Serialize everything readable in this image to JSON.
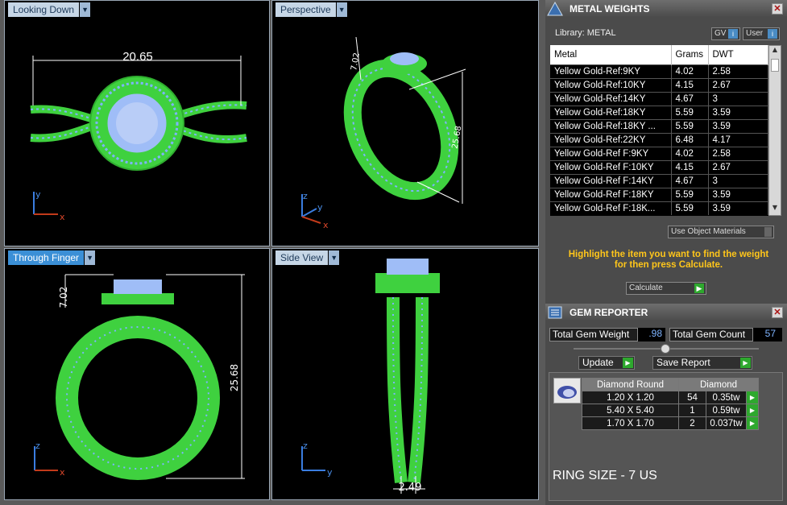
{
  "viewports": {
    "top_left": {
      "tab": "Looking Down",
      "dimension": "20.65",
      "axis_y": "y",
      "axis_x": "x"
    },
    "top_right": {
      "tab": "Perspective",
      "dim_height": "7.02",
      "dim_length": "25.68",
      "axis_z": "z",
      "axis_y": "y",
      "axis_x": "x"
    },
    "bottom_left": {
      "tab": "Through Finger",
      "dim_height": "7.02",
      "dim_length": "25.68",
      "axis_z": "z",
      "axis_x": "x"
    },
    "bottom_right": {
      "tab": "Side View",
      "dim_width": "2.49",
      "axis_z": "z",
      "axis_y": "y"
    }
  },
  "metal_weights": {
    "title": "METAL WEIGHTS",
    "library": "Library: METAL",
    "gv_label": "GV",
    "user_label": "User",
    "columns": [
      "Metal",
      "Grams",
      "DWT"
    ],
    "rows": [
      [
        "Yellow Gold-Ref:9KY",
        "4.02",
        "2.58"
      ],
      [
        "Yellow Gold-Ref:10KY",
        "4.15",
        "2.67"
      ],
      [
        "Yellow Gold-Ref:14KY",
        "4.67",
        "3"
      ],
      [
        "Yellow Gold-Ref:18KY",
        "5.59",
        "3.59"
      ],
      [
        "Yellow Gold-Ref:18KY ...",
        "5.59",
        "3.59"
      ],
      [
        "Yellow Gold-Ref:22KY",
        "6.48",
        "4.17"
      ],
      [
        "Yellow Gold-Ref F:9KY",
        "4.02",
        "2.58"
      ],
      [
        "Yellow Gold-Ref F:10KY",
        "4.15",
        "2.67"
      ],
      [
        "Yellow Gold-Ref F:14KY",
        "4.67",
        "3"
      ],
      [
        "Yellow Gold-Ref F:18KY",
        "5.59",
        "3.59"
      ],
      [
        "Yellow Gold-Ref F:18K...",
        "5.59",
        "3.59"
      ]
    ],
    "use_object_materials": "Use Object Materials",
    "hint_line1": "Highlight the item you want to find the weight",
    "hint_line2": "for then press Calculate.",
    "calculate_label": "Calculate"
  },
  "gem_reporter": {
    "title": "GEM REPORTER",
    "total_weight_label": "Total Gem Weight",
    "total_weight_value": ".98",
    "total_count_label": "Total Gem Count",
    "total_count_value": "57",
    "update_label": "Update",
    "save_report_label": "Save Report",
    "table_headers": [
      "Diamond Round",
      "Diamond"
    ],
    "gems": [
      {
        "size": "1.20 X 1.20",
        "count": "54",
        "weight": "0.35tw"
      },
      {
        "size": "5.40 X 5.40",
        "count": "1",
        "weight": "0.59tw"
      },
      {
        "size": "1.70 X 1.70",
        "count": "2",
        "weight": "0.037tw"
      }
    ],
    "ring_size": "RING SIZE - 7 US"
  },
  "colors": {
    "ring_green": "#3fd13f",
    "gem_blue": "#7aa6ff",
    "highlight_yellow": "#ffc61a",
    "go_green": "#2ea82e"
  }
}
